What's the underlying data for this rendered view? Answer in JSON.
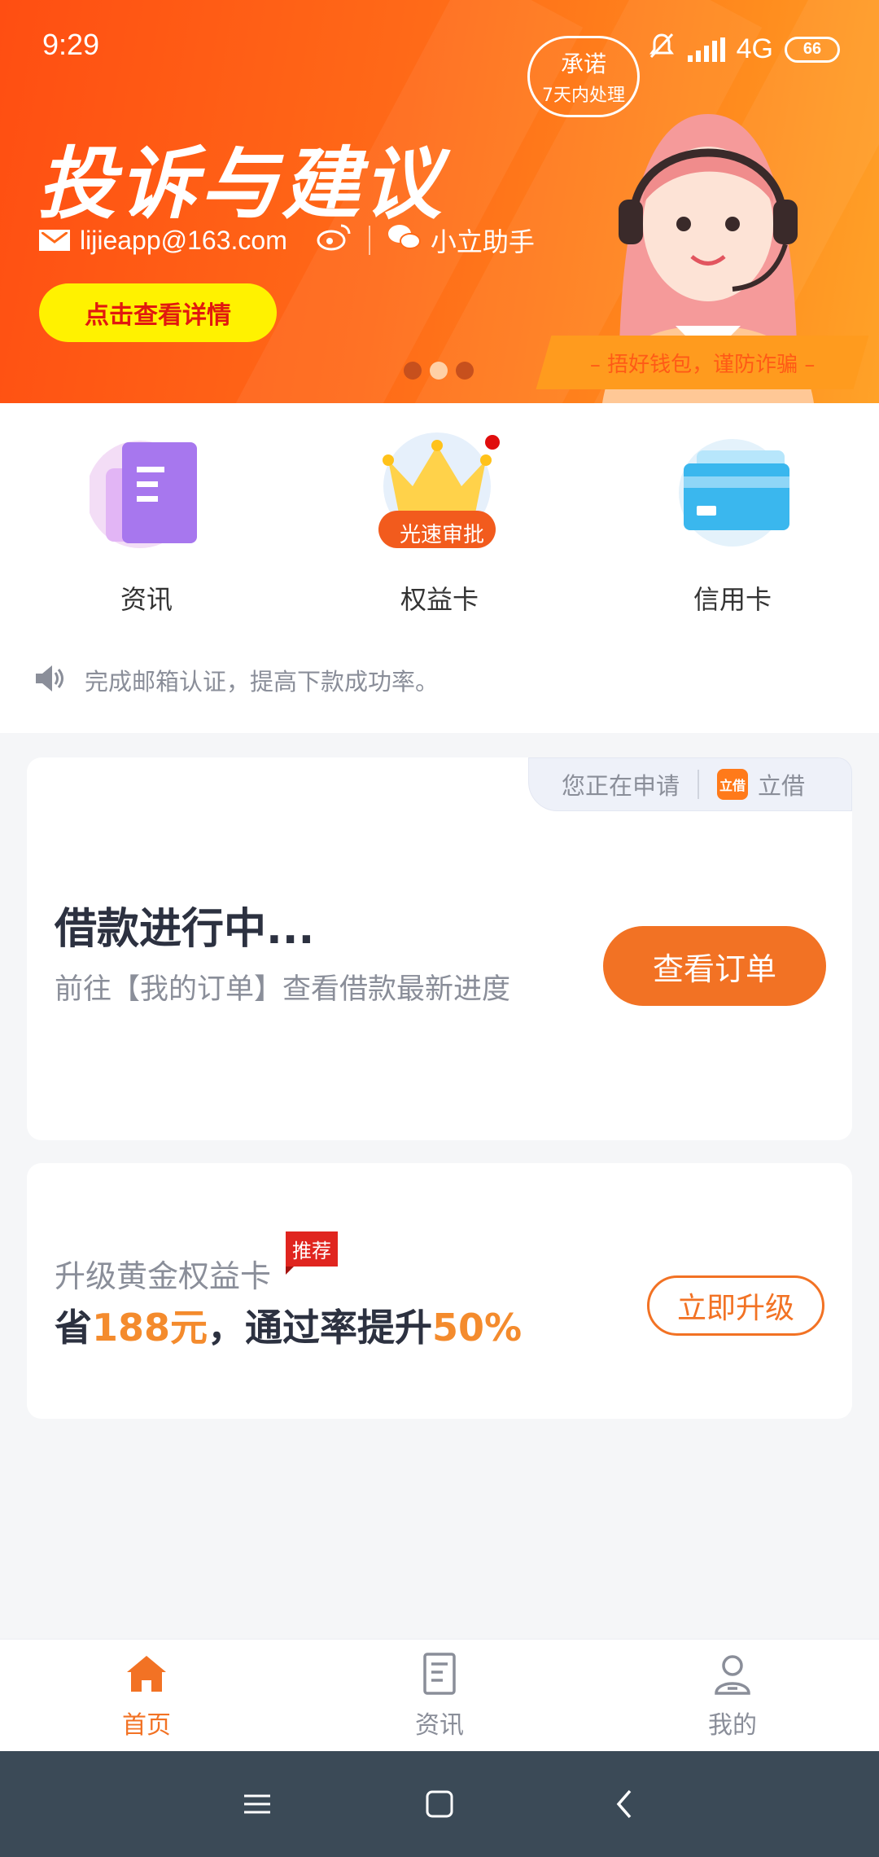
{
  "status_bar": {
    "time": "9:29",
    "network": "4G",
    "battery": "66"
  },
  "banner": {
    "title": "投诉与建议",
    "email": "lijieapp@163.com",
    "wechat": "小立助手",
    "cta": "点击查看详情",
    "bubble_line1": "承诺",
    "bubble_line2": "7天内处理",
    "slogan": "– 捂好钱包，谨防诈骗 –",
    "slide_count": 3,
    "active_slide": 2
  },
  "quick_menu": {
    "items": [
      {
        "label": "资讯"
      },
      {
        "label": "权益卡",
        "badge": "光速审批"
      },
      {
        "label": "信用卡"
      }
    ]
  },
  "notice": {
    "text": "完成邮箱认证，提高下款成功率。"
  },
  "loan_card": {
    "applying_label": "您正在申请",
    "app_logo_text": "立借",
    "app_name": "立借",
    "title": "借款进行中...",
    "subtitle": "前往【我的订单】查看借款最新进度",
    "button": "查看订单"
  },
  "upgrade_card": {
    "title": "升级黄金权益卡",
    "badge": "推荐",
    "line_prefix": "省",
    "save_amount": "188元",
    "line_mid": "，通过率提升",
    "rate": "50%",
    "button": "立即升级"
  },
  "tabbar": {
    "items": [
      {
        "label": "首页",
        "active": true
      },
      {
        "label": "资讯",
        "active": false
      },
      {
        "label": "我的",
        "active": false
      }
    ]
  },
  "colors": {
    "accent": "#f27224",
    "banner": "#ff5a16",
    "cta_yellow": "#fff200",
    "badge_red": "#e0251f"
  }
}
